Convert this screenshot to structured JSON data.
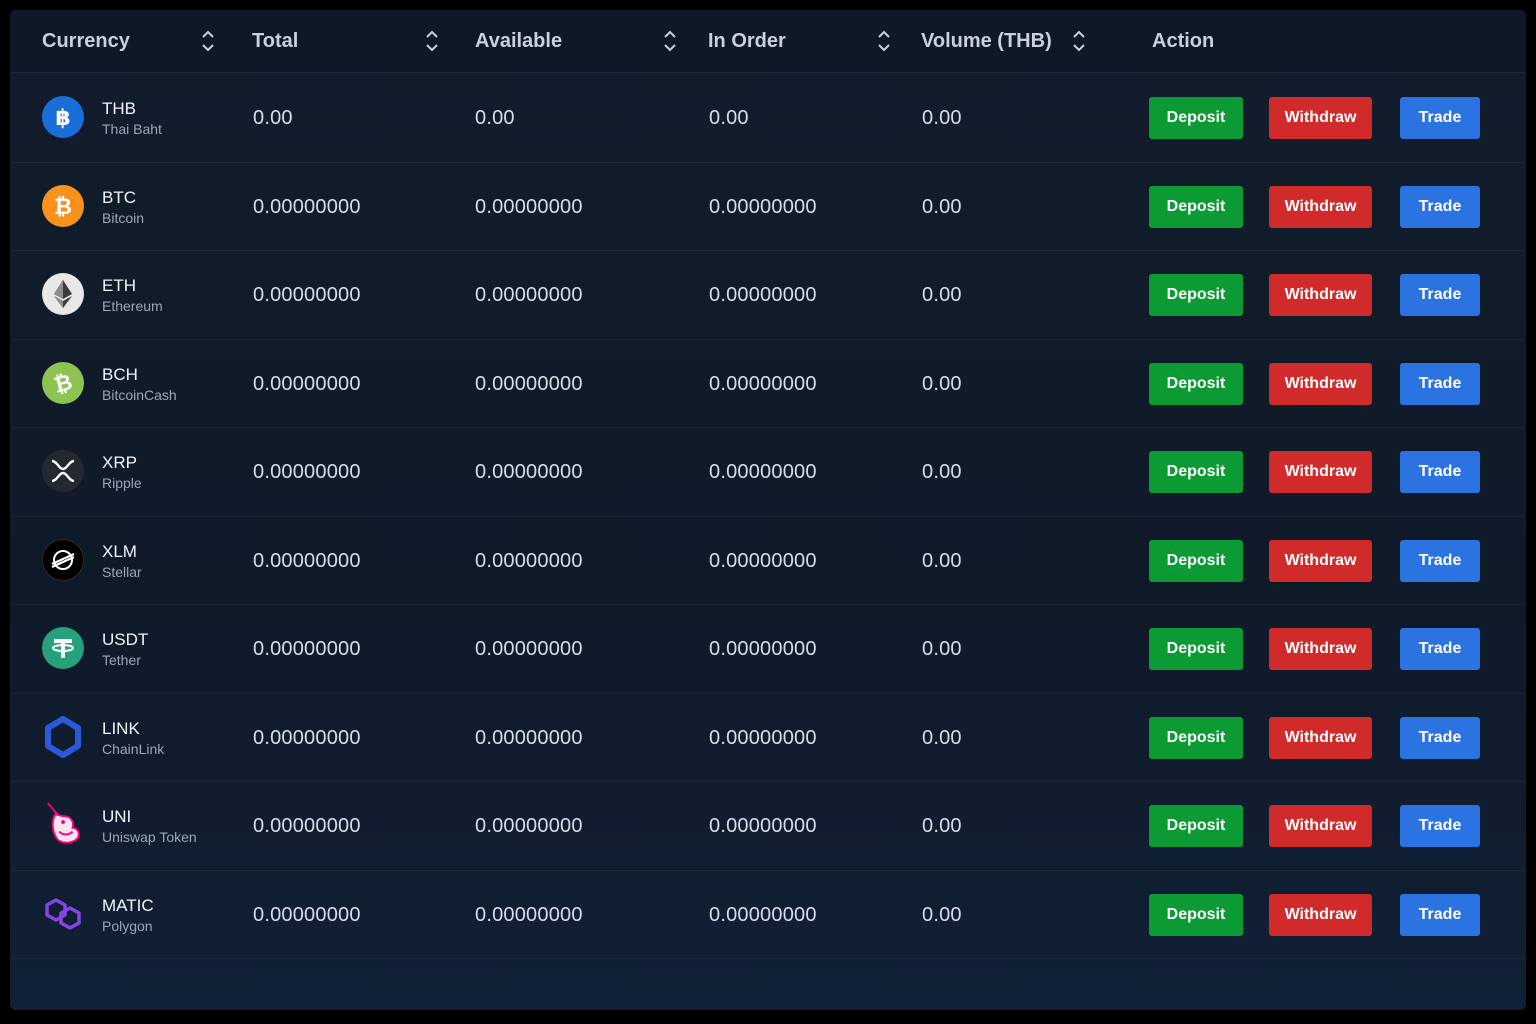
{
  "colors": {
    "deposit": "#0c9a34",
    "withdraw": "#d12a2a",
    "trade": "#2a73e0"
  },
  "columns": [
    {
      "label": "Currency",
      "sortable": true
    },
    {
      "label": "Total",
      "sortable": true
    },
    {
      "label": "Available",
      "sortable": true
    },
    {
      "label": "In Order",
      "sortable": true
    },
    {
      "label": "Volume (THB)",
      "sortable": true
    },
    {
      "label": "Action",
      "sortable": false
    }
  ],
  "actions": {
    "deposit": "Deposit",
    "withdraw": "Withdraw",
    "trade": "Trade"
  },
  "rows": [
    {
      "symbol": "THB",
      "name": "Thai Baht",
      "icon": "thai-baht-icon",
      "icon_color": "#1a6ed8",
      "total": "0.00",
      "available": "0.00",
      "in_order": "0.00",
      "volume": "0.00"
    },
    {
      "symbol": "BTC",
      "name": "Bitcoin",
      "icon": "bitcoin-icon",
      "icon_color": "#f7931a",
      "total": "0.00000000",
      "available": "0.00000000",
      "in_order": "0.00000000",
      "volume": "0.00"
    },
    {
      "symbol": "ETH",
      "name": "Ethereum",
      "icon": "ethereum-icon",
      "icon_color": "#e8e8e8",
      "total": "0.00000000",
      "available": "0.00000000",
      "in_order": "0.00000000",
      "volume": "0.00"
    },
    {
      "symbol": "BCH",
      "name": "BitcoinCash",
      "icon": "bitcoin-cash-icon",
      "icon_color": "#8dc351",
      "total": "0.00000000",
      "available": "0.00000000",
      "in_order": "0.00000000",
      "volume": "0.00"
    },
    {
      "symbol": "XRP",
      "name": "Ripple",
      "icon": "ripple-icon",
      "icon_color": "#23292f",
      "total": "0.00000000",
      "available": "0.00000000",
      "in_order": "0.00000000",
      "volume": "0.00"
    },
    {
      "symbol": "XLM",
      "name": "Stellar",
      "icon": "stellar-icon",
      "icon_color": "#000000",
      "total": "0.00000000",
      "available": "0.00000000",
      "in_order": "0.00000000",
      "volume": "0.00"
    },
    {
      "symbol": "USDT",
      "name": "Tether",
      "icon": "tether-icon",
      "icon_color": "#26a17b",
      "total": "0.00000000",
      "available": "0.00000000",
      "in_order": "0.00000000",
      "volume": "0.00"
    },
    {
      "symbol": "LINK",
      "name": "ChainLink",
      "icon": "chainlink-icon",
      "icon_color": "#2a5ada",
      "total": "0.00000000",
      "available": "0.00000000",
      "in_order": "0.00000000",
      "volume": "0.00"
    },
    {
      "symbol": "UNI",
      "name": "Uniswap Token",
      "icon": "uniswap-icon",
      "icon_color": "#ff007a",
      "total": "0.00000000",
      "available": "0.00000000",
      "in_order": "0.00000000",
      "volume": "0.00"
    },
    {
      "symbol": "MATIC",
      "name": "Polygon",
      "icon": "polygon-icon",
      "icon_color": "#8247e5",
      "total": "0.00000000",
      "available": "0.00000000",
      "in_order": "0.00000000",
      "volume": "0.00"
    }
  ]
}
